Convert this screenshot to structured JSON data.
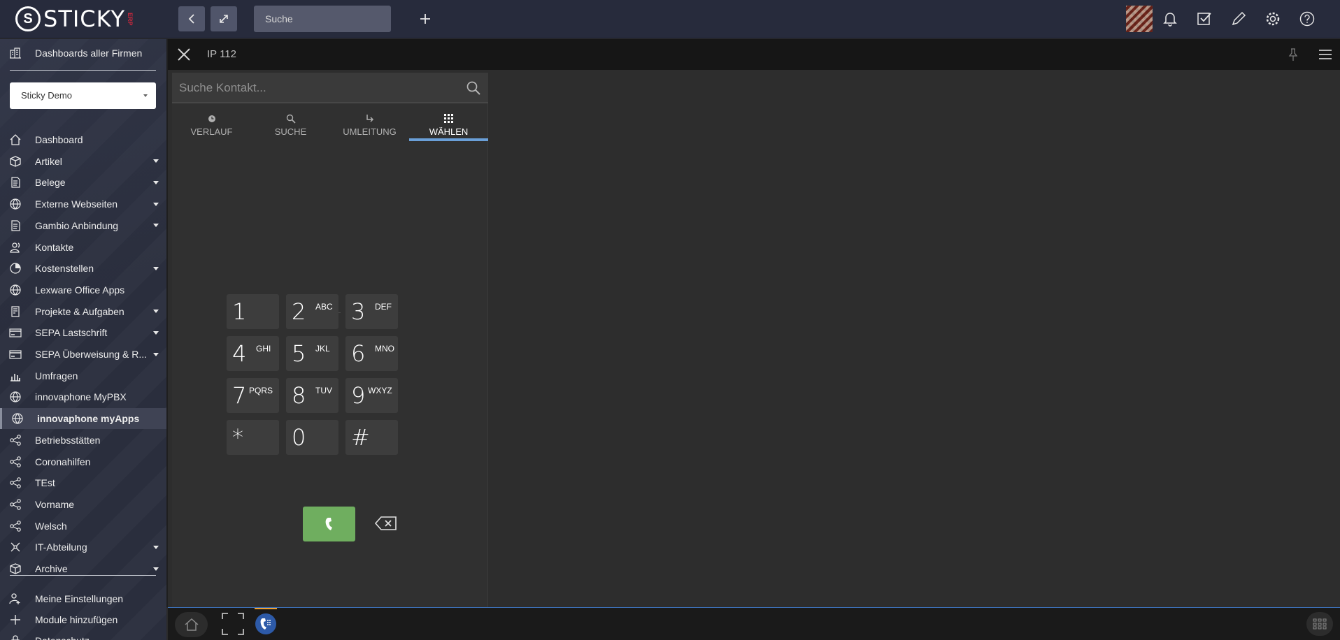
{
  "brand": {
    "word": "STICKY",
    "suffix": "ERP",
    "mark_letter": "S"
  },
  "topbar": {
    "search_placeholder": "Suche"
  },
  "sidebar": {
    "dashboards_label": "Dashboards aller Firmen",
    "company_select": "Sticky Demo",
    "items": [
      {
        "label": "Dashboard",
        "icon": "home-icon",
        "expandable": false
      },
      {
        "label": "Artikel",
        "icon": "box-icon",
        "expandable": true
      },
      {
        "label": "Belege",
        "icon": "document-icon",
        "expandable": true
      },
      {
        "label": "Externe Webseiten",
        "icon": "globe-icon",
        "expandable": true
      },
      {
        "label": "Gambio Anbindung",
        "icon": "document-icon",
        "expandable": true
      },
      {
        "label": "Kontakte",
        "icon": "contacts-icon",
        "expandable": false
      },
      {
        "label": "Kostenstellen",
        "icon": "pie-chart-icon",
        "expandable": true
      },
      {
        "label": "Lexware Office Apps",
        "icon": "globe-icon",
        "expandable": false
      },
      {
        "label": "Projekte & Aufgaben",
        "icon": "project-icon",
        "expandable": true
      },
      {
        "label": "SEPA Lastschrift",
        "icon": "card-icon",
        "expandable": true
      },
      {
        "label": "SEPA Überweisung & R...",
        "icon": "card-icon",
        "expandable": true
      },
      {
        "label": "Umfragen",
        "icon": "bar-chart-icon",
        "expandable": false
      },
      {
        "label": "innovaphone MyPBX",
        "icon": "globe-icon",
        "expandable": false
      },
      {
        "label": "innovaphone myApps",
        "icon": "globe-icon",
        "expandable": false,
        "active": true
      },
      {
        "label": "Betriebsstätten",
        "icon": "share-icon",
        "expandable": false
      },
      {
        "label": "Coronahilfen",
        "icon": "share-icon",
        "expandable": false
      },
      {
        "label": "TEst",
        "icon": "share-icon",
        "expandable": false
      },
      {
        "label": "Vorname",
        "icon": "share-icon",
        "expandable": false
      },
      {
        "label": "Welsch",
        "icon": "share-icon",
        "expandable": false
      },
      {
        "label": "IT-Abteilung",
        "icon": "network-icon",
        "expandable": true
      },
      {
        "label": "Archive",
        "icon": "box-icon",
        "expandable": true
      }
    ],
    "footer_items": [
      {
        "label": "Meine Einstellungen",
        "icon": "user-settings-icon"
      },
      {
        "label": "Module hinzufügen",
        "icon": "plus-icon"
      },
      {
        "label": "Datenschutz",
        "icon": "lock-icon"
      }
    ]
  },
  "panel": {
    "title": "IP 112"
  },
  "phone": {
    "search_placeholder": "Suche Kontakt...",
    "tabs": [
      {
        "label": "VERLAUF",
        "icon": "clock-icon"
      },
      {
        "label": "SUCHE",
        "icon": "search-icon"
      },
      {
        "label": "UMLEITUNG",
        "icon": "redirect-icon"
      },
      {
        "label": "WÄHLEN",
        "icon": "dialpad-icon",
        "selected": true
      }
    ],
    "keys": [
      {
        "digit": "1",
        "letters": ""
      },
      {
        "digit": "2",
        "letters": "ABC"
      },
      {
        "digit": "3",
        "letters": "DEF"
      },
      {
        "digit": "4",
        "letters": "GHI"
      },
      {
        "digit": "5",
        "letters": "JKL"
      },
      {
        "digit": "6",
        "letters": "MNO"
      },
      {
        "digit": "7",
        "letters": "PQRS"
      },
      {
        "digit": "8",
        "letters": "TUV"
      },
      {
        "digit": "9",
        "letters": "WXYZ"
      },
      {
        "digit": "*",
        "letters": ""
      },
      {
        "digit": "0",
        "letters": ""
      },
      {
        "digit": "#",
        "letters": ""
      }
    ]
  },
  "colors": {
    "accent": "#6a9fd8",
    "call_green": "#6fae5f",
    "brand_red": "#c7283c"
  }
}
